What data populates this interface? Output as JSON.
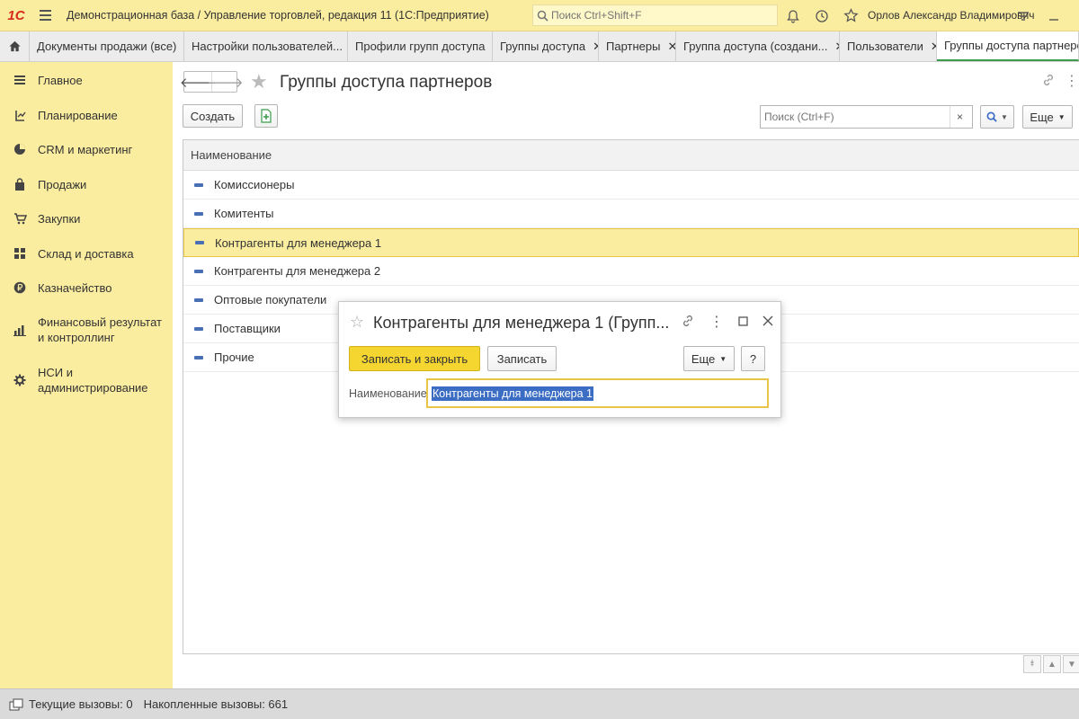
{
  "titlebar": {
    "logo": "1С",
    "app_title": "Демонстрационная база / Управление торговлей, редакция 11  (1С:Предприятие)",
    "search_placeholder": "Поиск Ctrl+Shift+F",
    "user_name": "Орлов Александр Владимирович"
  },
  "tabs": [
    {
      "label": "Документы продажи (все)"
    },
    {
      "label": "Настройки пользователей..."
    },
    {
      "label": "Профили групп доступа"
    },
    {
      "label": "Группы доступа"
    },
    {
      "label": "Партнеры"
    },
    {
      "label": "Группа доступа (создани..."
    },
    {
      "label": "Пользователи"
    },
    {
      "label": "Группы доступа партнеров"
    }
  ],
  "sidebar": {
    "items": [
      {
        "label": "Главное",
        "icon": "menu-lines-icon"
      },
      {
        "label": "Планирование",
        "icon": "planning-icon"
      },
      {
        "label": "CRM и маркетинг",
        "icon": "pie-chart-icon"
      },
      {
        "label": "Продажи",
        "icon": "shopping-bag-icon"
      },
      {
        "label": "Закупки",
        "icon": "cart-icon"
      },
      {
        "label": "Склад и доставка",
        "icon": "warehouse-icon"
      },
      {
        "label": "Казначейство",
        "icon": "ruble-coin-icon"
      },
      {
        "label": "Финансовый результат и контроллинг",
        "icon": "bar-chart-icon"
      },
      {
        "label": "НСИ и администрирование",
        "icon": "gear-icon"
      }
    ]
  },
  "main": {
    "title": "Группы доступа партнеров",
    "create_label": "Создать",
    "search_placeholder": "Поиск (Ctrl+F)",
    "clear_label": "×",
    "more_label": "Еще",
    "column_header": "Наименование",
    "rows": [
      "Комиссионеры",
      "Комитенты",
      "Контрагенты для менеджера 1",
      "Контрагенты для менеджера 2",
      "Оптовые покупатели",
      "Поставщики",
      "Прочие"
    ],
    "selected_row": 2
  },
  "dialog": {
    "title": "Контрагенты для менеджера 1 (Групп...",
    "save_close_label": "Записать и закрыть",
    "save_label": "Записать",
    "more_label": "Еще",
    "help_label": "?",
    "field_label": "Наименование:",
    "field_value": "Контрагенты для менеджера 1"
  },
  "statusbar": {
    "current_calls": "Текущие вызовы: 0",
    "accumulated_calls": "Накопленные вызовы: 661"
  },
  "colors": {
    "accent_yellow": "#fbeda0",
    "primary_button": "#f5d631",
    "selection_border": "#e8c547",
    "active_tab_underline": "#3a9c4c",
    "logo_red": "#d62a1e"
  }
}
